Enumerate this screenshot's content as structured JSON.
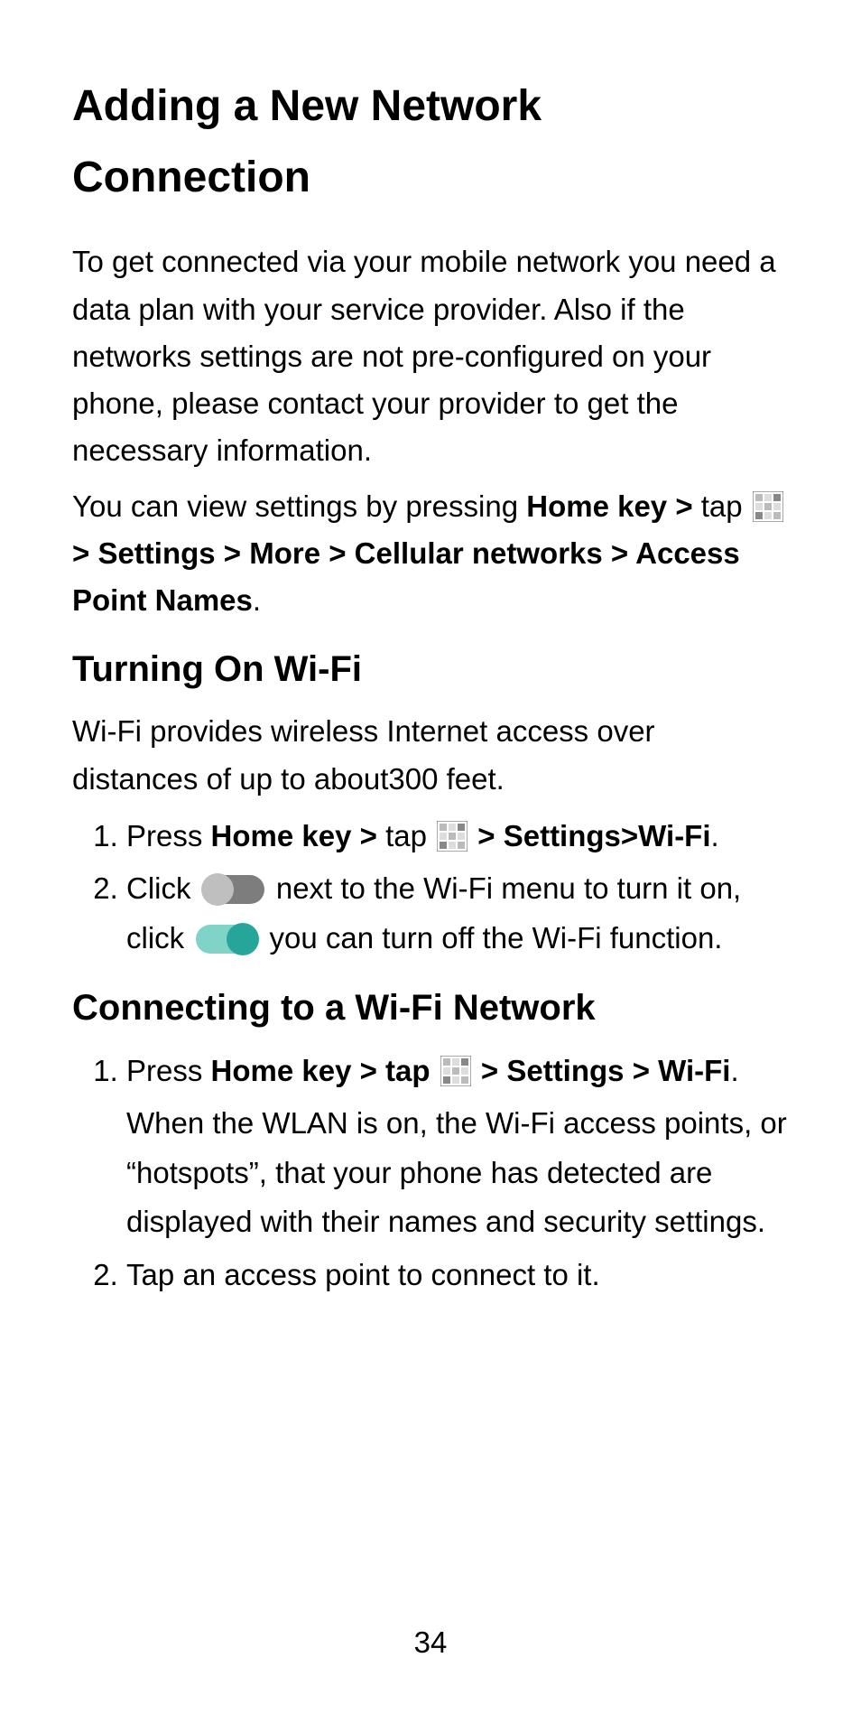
{
  "title": "Adding a New Network Connection",
  "intro_p1": "To get connected via your mobile network you need a data plan with your service provider. Also if the networks settings are not pre-configured on your phone, please contact your provider to get the necessary information.",
  "intro_p2_a": "You can view settings by pressing ",
  "intro_p2_b": "Home key > ",
  "intro_p2_c": "tap ",
  "intro_p2_d": " > Settings > More > Cellular networks > Access Point Names",
  "intro_p2_e": ".",
  "section2_title": "Turning On Wi-Fi",
  "section2_intro": "Wi-Fi provides wireless Internet access over distances of up to about300 feet.",
  "s2_step1_a": "Press ",
  "s2_step1_b": "Home key > ",
  "s2_step1_c": "tap ",
  "s2_step1_d": " > Settings>Wi-Fi",
  "s2_step1_e": ".",
  "s2_step2_a": "Click ",
  "s2_step2_b": " next to the Wi-Fi menu to turn it on, click ",
  "s2_step2_c": " you can turn off the Wi-Fi function.",
  "section3_title": "Connecting to a Wi-Fi Network",
  "s3_step1_a": "Press ",
  "s3_step1_b": "Home key > tap ",
  "s3_step1_c": " > Settings > Wi-Fi",
  "s3_step1_d": ".",
  "s3_step1_desc": "When the WLAN is on, the Wi-Fi access points, or “hotspots”, that your phone has detected are displayed with their names and security settings.",
  "s3_step2": "Tap an access point to connect to it.",
  "page_number": "34"
}
